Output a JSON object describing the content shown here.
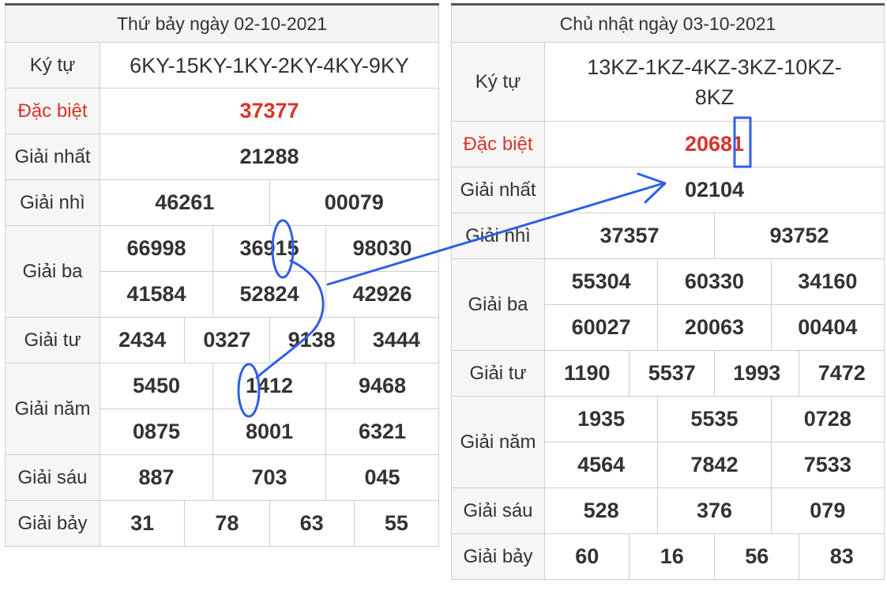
{
  "left": {
    "title": "Thứ bảy ngày 02-10-2021",
    "rows": {
      "ky_tu": {
        "label": "Ký tự",
        "value": "6KY-15KY-1KY-2KY-4KY-9KY"
      },
      "dac_biet": {
        "label": "Đặc biệt",
        "value": "37377"
      },
      "giai_nhat": {
        "label": "Giải nhất",
        "value": "21288"
      },
      "giai_nhi": {
        "label": "Giải nhì",
        "values": [
          "46261",
          "00079"
        ]
      },
      "giai_ba": {
        "label": "Giải ba",
        "values": [
          "66998",
          "36915",
          "98030",
          "41584",
          "52824",
          "42926"
        ]
      },
      "giai_tu": {
        "label": "Giải tư",
        "values": [
          "2434",
          "0327",
          "9138",
          "3444"
        ]
      },
      "giai_nam": {
        "label": "Giải năm",
        "values": [
          "5450",
          "1412",
          "9468",
          "0875",
          "8001",
          "6321"
        ]
      },
      "giai_sau": {
        "label": "Giải sáu",
        "values": [
          "887",
          "703",
          "045"
        ]
      },
      "giai_bay": {
        "label": "Giải bảy",
        "values": [
          "31",
          "78",
          "63",
          "55"
        ]
      }
    }
  },
  "right": {
    "title": "Chủ nhật ngày 03-10-2021",
    "rows": {
      "ky_tu": {
        "label": "Ký tự",
        "value_line1": "13KZ-1KZ-4KZ-3KZ-10KZ-",
        "value_line2": "8KZ"
      },
      "dac_biet": {
        "label": "Đặc biệt",
        "value": "20681"
      },
      "giai_nhat": {
        "label": "Giải nhất",
        "value": "02104"
      },
      "giai_nhi": {
        "label": "Giải nhì",
        "values": [
          "37357",
          "93752"
        ]
      },
      "giai_ba": {
        "label": "Giải ba",
        "values": [
          "55304",
          "60330",
          "34160",
          "60027",
          "20063",
          "00404"
        ]
      },
      "giai_tu": {
        "label": "Giải tư",
        "values": [
          "1190",
          "5537",
          "1993",
          "7472"
        ]
      },
      "giai_nam": {
        "label": "Giải năm",
        "values": [
          "1935",
          "5535",
          "0728",
          "4564",
          "7842",
          "7533"
        ]
      },
      "giai_sau": {
        "label": "Giải sáu",
        "values": [
          "528",
          "376",
          "079"
        ]
      },
      "giai_bay": {
        "label": "Giải bảy",
        "values": [
          "60",
          "16",
          "56",
          "83"
        ]
      }
    }
  },
  "colors": {
    "special": "#d9342b",
    "annotation": "#2f5ee8"
  }
}
